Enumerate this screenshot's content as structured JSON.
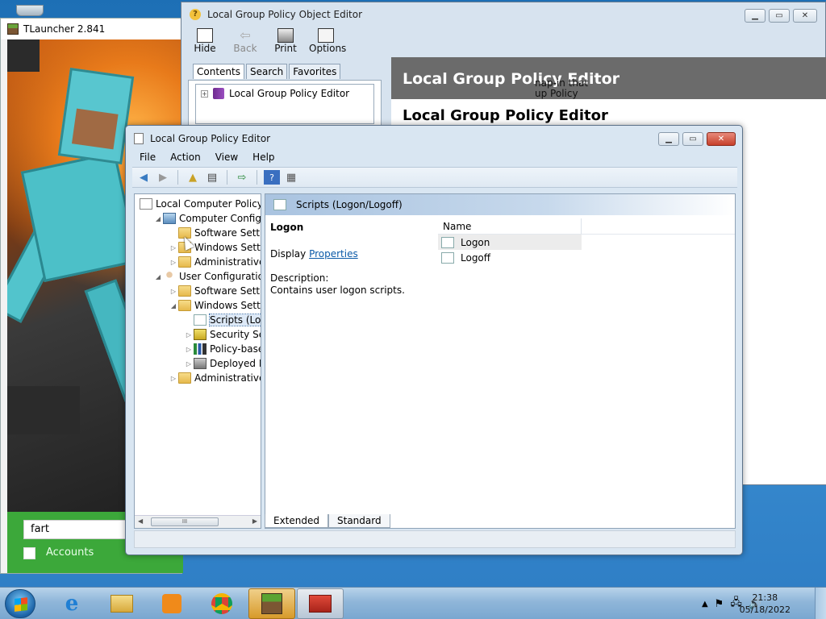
{
  "tlauncher": {
    "title": "TLauncher 2.841",
    "search_value": "fart",
    "accounts_label": "Accounts",
    "colors": {
      "bottom": "#3ca83a"
    }
  },
  "gpo_editor": {
    "title": "Local Group Policy Object Editor",
    "toolbar": [
      {
        "label": "Hide",
        "icon": "hide-icon",
        "enabled": true
      },
      {
        "label": "Back",
        "icon": "back-arrow-icon",
        "enabled": false
      },
      {
        "label": "Print",
        "icon": "print-icon",
        "enabled": true
      },
      {
        "label": "Options",
        "icon": "options-icon",
        "enabled": true
      }
    ],
    "tabs": [
      "Contents",
      "Search",
      "Favorites"
    ],
    "tree_item": "Local Group Policy Editor",
    "banner": "Local Group Policy Editor",
    "heading": "Local Group Policy Editor",
    "snippet_line1": "nap-in that",
    "snippet_line2": "up Policy"
  },
  "main_window": {
    "title": "Local Group Policy Editor",
    "menus": [
      "File",
      "Action",
      "View",
      "Help"
    ],
    "tree": [
      {
        "label": "Local Computer Policy",
        "icon": "policy-icon",
        "level": 0,
        "expander": ""
      },
      {
        "label": "Computer Configura",
        "icon": "computer-icon",
        "level": 1,
        "expander": "◢"
      },
      {
        "label": "Software Settings",
        "icon": "folder-icon",
        "level": 2,
        "expander": ""
      },
      {
        "label": "Windows Setting",
        "icon": "folder-icon",
        "level": 2,
        "expander": "▷"
      },
      {
        "label": "Administrative Te",
        "icon": "folder-icon",
        "level": 2,
        "expander": "▷"
      },
      {
        "label": "User Configuration",
        "icon": "user-icon",
        "level": 1,
        "expander": "◢"
      },
      {
        "label": "Software Settings",
        "icon": "folder-icon",
        "level": 2,
        "expander": "▷"
      },
      {
        "label": "Windows Setting",
        "icon": "folder-icon",
        "level": 2,
        "expander": "◢"
      },
      {
        "label": "Scripts (Logon",
        "icon": "scroll-icon",
        "level": 3,
        "expander": "",
        "selected": true
      },
      {
        "label": "Security Settir",
        "icon": "lock-icon",
        "level": 3,
        "expander": "▷"
      },
      {
        "label": "Policy-based",
        "icon": "chart-icon",
        "level": 3,
        "expander": "▷"
      },
      {
        "label": "Deployed Prir",
        "icon": "printer-icon",
        "level": 3,
        "expander": "▷"
      },
      {
        "label": "Administrative Te",
        "icon": "folder-icon",
        "level": 2,
        "expander": "▷"
      }
    ],
    "hscroll_thumb": "III",
    "details": {
      "header": "Scripts (Logon/Logoff)",
      "item_title": "Logon",
      "display_prefix": "Display",
      "properties_link": "Properties",
      "description_label": "Description:",
      "description_text": "Contains user logon scripts.",
      "column_name": "Name",
      "items": [
        "Logon",
        "Logoff"
      ]
    },
    "bottom_tabs": [
      "Extended",
      "Standard"
    ]
  },
  "taskbar": {
    "time": "21:38",
    "date": "05/18/2022"
  }
}
